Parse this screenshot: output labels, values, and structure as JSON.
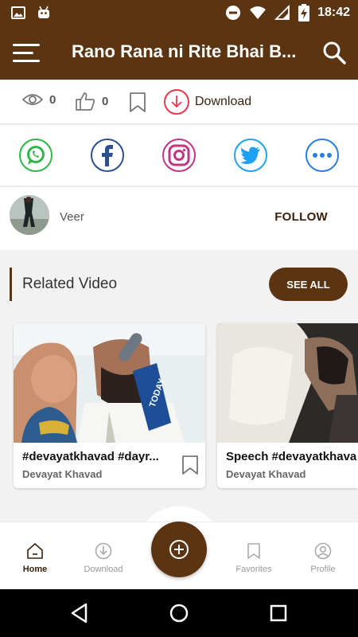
{
  "status_bar": {
    "time": "18:42",
    "left_icons": [
      "image-icon",
      "android-icon"
    ],
    "right_icons": [
      "do-not-disturb-icon",
      "wifi-icon",
      "signal-icon",
      "battery-charging-icon"
    ]
  },
  "app_bar": {
    "title": "Rano Rana ni Rite Bhai B...",
    "menu_icon": "hamburger-menu-icon",
    "search_icon": "search-icon"
  },
  "stats": {
    "views": "0",
    "likes": "0",
    "download_label": "Download"
  },
  "share": [
    "whatsapp",
    "facebook",
    "instagram",
    "twitter",
    "more"
  ],
  "user": {
    "name": "Veer",
    "follow_label": "FOLLOW"
  },
  "related": {
    "title": "Related Video",
    "see_all_label": "SEE ALL",
    "videos": [
      {
        "title": "#devayatkhavad #dayr...",
        "author": "Devayat Khavad"
      },
      {
        "title": "Speech #devayatkhavad",
        "author": "Devayat Khavad"
      }
    ]
  },
  "bottom_nav": {
    "items": [
      {
        "label": "Home",
        "icon": "home-icon",
        "active": true
      },
      {
        "label": "Download",
        "icon": "download-icon",
        "active": false
      },
      {
        "label": "Favorites",
        "icon": "bookmark-icon",
        "active": false
      },
      {
        "label": "Profile",
        "icon": "profile-icon",
        "active": false
      }
    ],
    "fab_icon": "add-circle-icon"
  },
  "colors": {
    "primary": "#5b3412",
    "download_red": "#e53950",
    "whatsapp": "#2fb745",
    "facebook": "#2d4f8f",
    "instagram": "#c13584",
    "twitter": "#1da1f2",
    "more": "#2a7de1"
  }
}
